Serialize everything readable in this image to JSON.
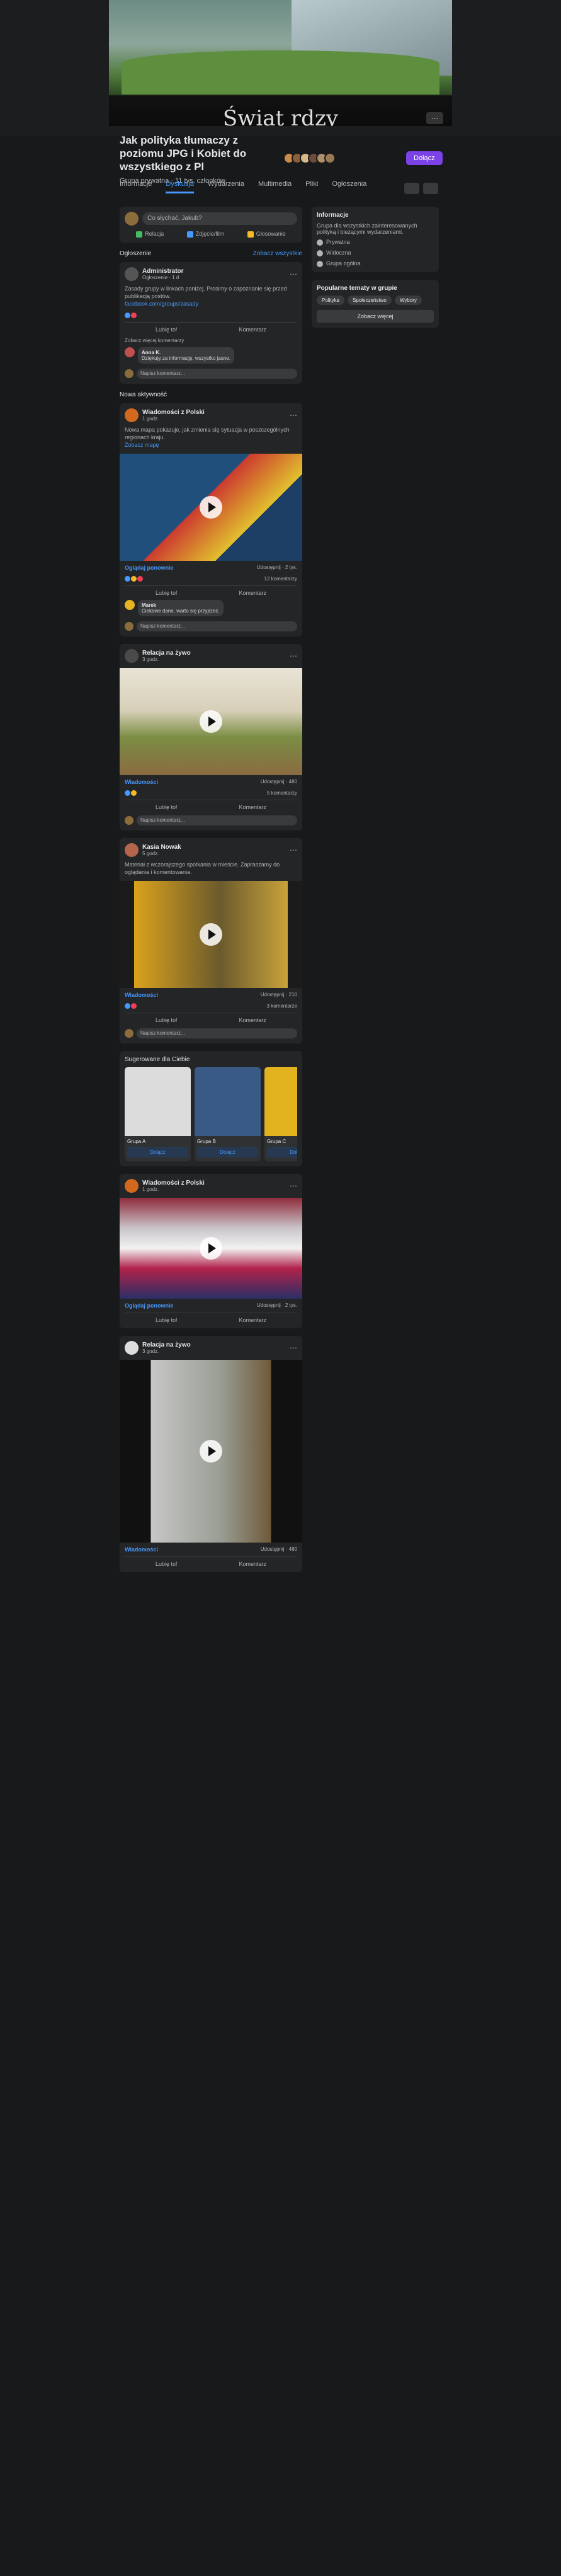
{
  "group": {
    "title": "Jak polityka tłumaczy z poziomu JPG i Kobiet do wszystkiego z Pl",
    "meta": "Grupa prywatna · 11 tys. członków",
    "join": "Dołącz",
    "cover_text": "Świat rdzy"
  },
  "tabs": [
    "Informacje",
    "Dyskusja",
    "Wydarzenia",
    "Multimedia",
    "Pliki",
    "Ogłoszenia"
  ],
  "composer": {
    "placeholder": "Co słychać, Jakub?",
    "actions": [
      "Relacja",
      "Zdjęcie/film",
      "Głosowanie"
    ]
  },
  "section": {
    "label": "Ogłoszenie",
    "more": "Zobacz wszystkie"
  },
  "pinned": {
    "author": "Administrator",
    "meta": "Ogłoszenie · 1 d",
    "text": "Zasady grupy w linkach poniżej. Prosimy o zapoznanie się przed publikacją postów.",
    "link": "facebook.com/groups/zasady",
    "actions": [
      "Lubię to!",
      "Komentarz"
    ],
    "comments_label": "Zobacz więcej komentarzy",
    "comment_author": "Anna K.",
    "comment_text": "Dziękuję za informację, wszystko jasne.",
    "reply_placeholder": "Napisz komentarz..."
  },
  "feed_label": "Nowa aktywność",
  "posts": [
    {
      "author": "Wiadomości z Polski",
      "meta": "1 godz.",
      "text": "Nowa mapa pokazuje, jak zmienia się sytuacja w poszczególnych regionach kraju.",
      "link": "Zobacz mapę",
      "caption_left": "Oglądaj ponownie",
      "caption_right": "Udostępnij · 2 tys.",
      "stats_right": "12 komentarzy",
      "actions": [
        "Lubię to!",
        "Komentarz"
      ],
      "comment_author": "Marek",
      "comment_text": "Ciekawe dane, warto się przyjrzeć.",
      "reply_placeholder": "Napisz komentarz..."
    },
    {
      "author": "Relacja na żywo",
      "meta": "3 godz.",
      "text": "",
      "link": "",
      "caption_left": "Wiadomości",
      "caption_right": "Udostępnij · 480",
      "stats_right": "5 komentarzy",
      "actions": [
        "Lubię to!",
        "Komentarz"
      ],
      "comment_author": "",
      "comment_text": "",
      "reply_placeholder": "Napisz komentarz..."
    },
    {
      "author": "Kasia Nowak",
      "meta": "5 godz.",
      "text": "Materiał z wczorajszego spotkania w mieście. Zapraszamy do oglądania i komentowania.",
      "link": "",
      "caption_left": "Wiadomości",
      "caption_right": "Udostępnij · 210",
      "stats_right": "3 komentarze",
      "actions": [
        "Lubię to!",
        "Komentarz"
      ],
      "comment_author": "",
      "comment_text": "",
      "reply_placeholder": "Napisz komentarz..."
    }
  ],
  "stories": {
    "label": "Sugerowane dla Ciebie",
    "items": [
      {
        "name": "Grupa A",
        "button": "Dołącz"
      },
      {
        "name": "Grupa B",
        "button": "Dołącz"
      },
      {
        "name": "Grupa C",
        "button": "Dołącz"
      }
    ]
  },
  "sidebar": {
    "info_title": "Informacje",
    "info_text": "Grupa dla wszystkich zainteresowanych polityką i bieżącymi wydarzeniami.",
    "items": [
      "Prywatna",
      "Widoczna",
      "Grupa ogólna"
    ],
    "tags_title": "Popularne tematy w grupie",
    "tags": [
      "Polityka",
      "Społeczeństwo",
      "Wybory"
    ],
    "more_button": "Zobacz więcej"
  }
}
